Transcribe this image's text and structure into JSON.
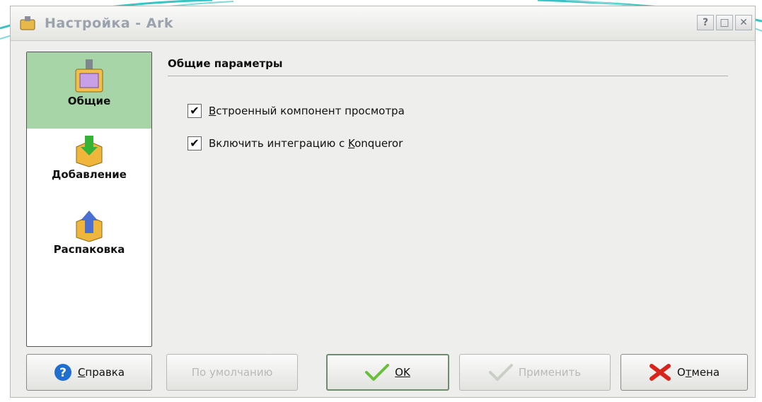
{
  "window": {
    "title": "Настройка - Ark",
    "help_btn": "?",
    "maximize_btn": "□",
    "close_btn": "✕"
  },
  "sidebar": {
    "items": [
      {
        "label": "Общие",
        "icon": "folder-archive-icon",
        "active": true
      },
      {
        "label": "Добавление",
        "icon": "package-add-icon",
        "active": false
      },
      {
        "label": "Распаковка",
        "icon": "package-extract-icon",
        "active": false
      }
    ]
  },
  "main": {
    "header": "Общие параметры",
    "options": [
      {
        "prefix": "",
        "mnemonic": "В",
        "rest": "строенный компонент просмотра",
        "checked": true
      },
      {
        "prefix": "Включить интеграцию с ",
        "mnemonic": "K",
        "rest": "onqueror",
        "checked": true
      }
    ]
  },
  "buttons": {
    "help": {
      "mnemonic": "С",
      "rest": "правка"
    },
    "defaults": "По умолчанию",
    "ok": "OK",
    "apply": "Применить",
    "cancel": {
      "prefix": "О",
      "mnemonic": "т",
      "rest": "мена"
    }
  },
  "colors": {
    "active_sidebar": "#a8d5a8",
    "help_icon": "#1f6fd1",
    "ok_check": "#6abf3a",
    "cancel_icon": "#d9241c"
  }
}
